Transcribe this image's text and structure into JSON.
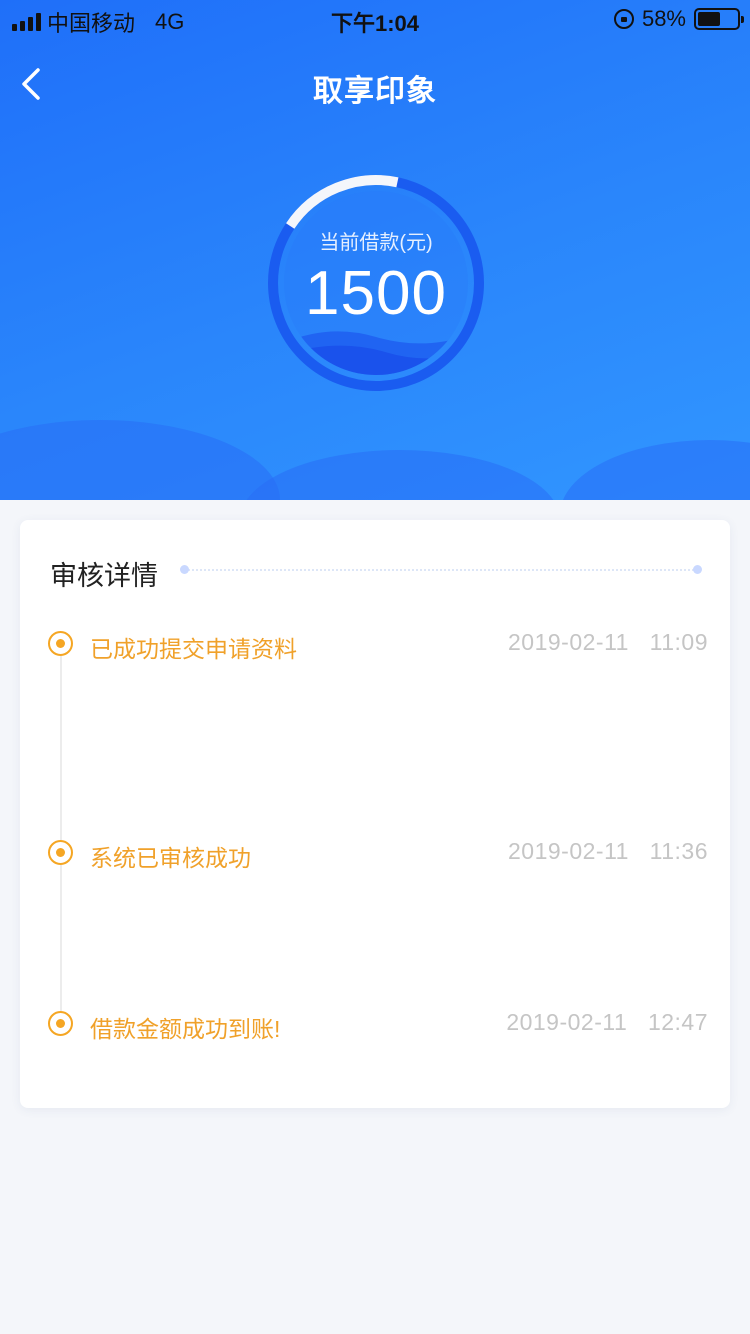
{
  "status_bar": {
    "carrier": "中国移动",
    "network": "4G",
    "time": "下午1:04",
    "battery_percent": "58%",
    "battery_level": 0.58
  },
  "nav": {
    "title": "取享印象"
  },
  "gauge": {
    "label": "当前借款(元)",
    "value": "1500",
    "progress_fraction": 0.1
  },
  "review": {
    "title": "审核详情",
    "steps": [
      {
        "text": "已成功提交申请资料",
        "date": "2019-02-11",
        "time": "11:09"
      },
      {
        "text": "系统已审核成功",
        "date": "2019-02-11",
        "time": "11:36"
      },
      {
        "text": "借款金额成功到账!",
        "date": "2019-02-11",
        "time": "12:47"
      }
    ]
  },
  "colors": {
    "primary": "#2a86fb",
    "accent_orange": "#f5a623",
    "muted": "#c5c5c5"
  }
}
